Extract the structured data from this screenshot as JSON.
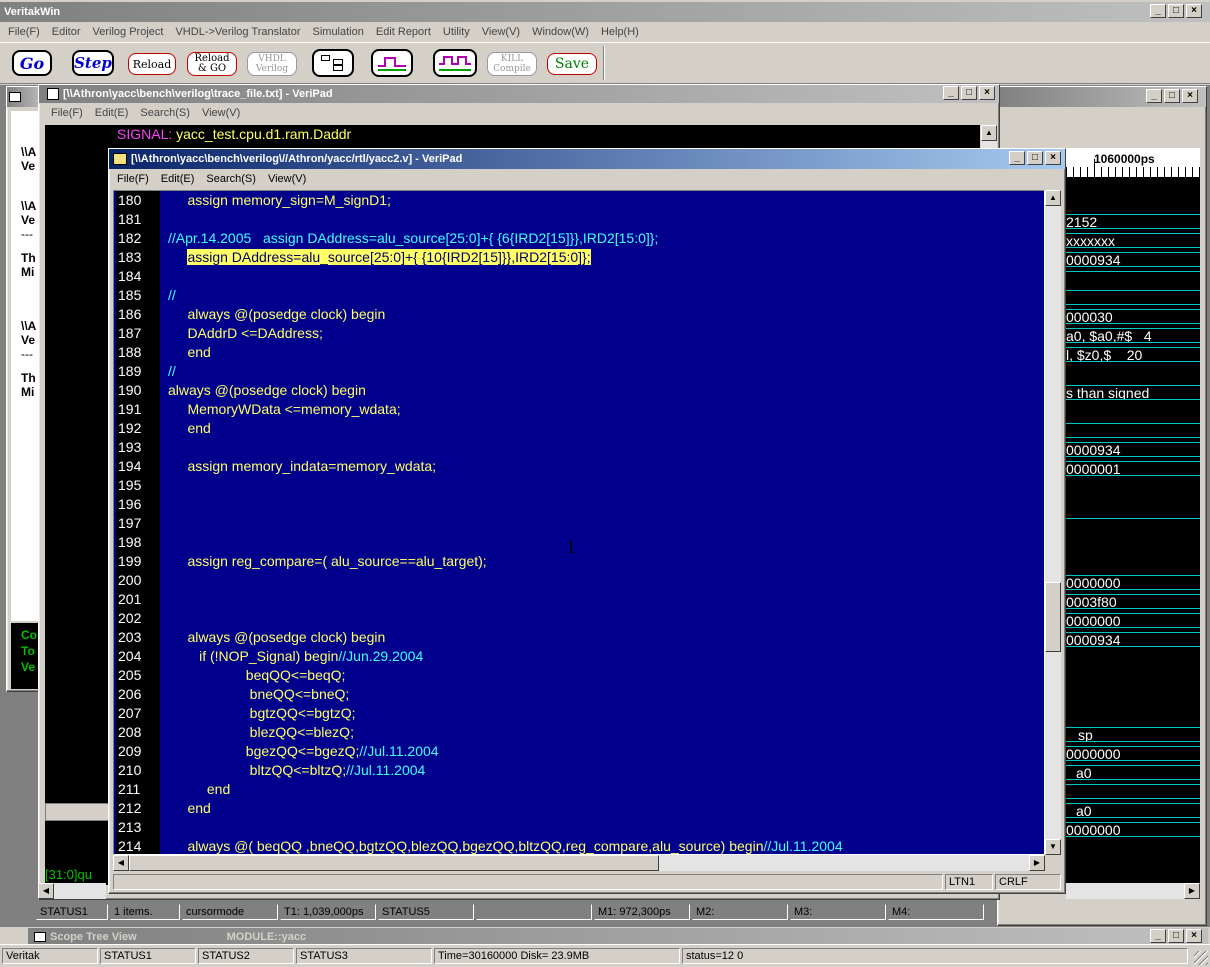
{
  "app": {
    "title": "VeritakWin",
    "menu": [
      "File(F)",
      "Editor",
      "Verilog Project",
      "VHDL->Verilog Translator",
      "Simulation",
      "Edit Report",
      "Utility",
      "View(V)",
      "Window(W)",
      "Help(H)"
    ],
    "toolbar": {
      "go": "Go",
      "step": "Step",
      "reload": "Reload",
      "reload_go_1": "Reload",
      "reload_go_2": "& GO",
      "vhdl_1": "VHDL",
      "vhdl_2": "Verilog",
      "kill_1": "KILL",
      "kill_2": "Compile",
      "save": "Save"
    },
    "status": [
      "Veritak",
      "STATUS1",
      "STATUS2",
      "STATUS3",
      "Time=30160000 Disk= 23.9MB",
      "status=12 0"
    ]
  },
  "trace_window": {
    "title": "[\\\\Athron\\yacc\\bench\\verilog\\trace_file.txt] - VeriPad",
    "menu": [
      "File(F)",
      "Edit(E)",
      "Search(S)",
      "View(V)"
    ],
    "signal_label": "SIGNAL:",
    "signal_value": "yacc_test.cpu.d1.ram.Daddr",
    "bottom_text": "[31:0]qu"
  },
  "left_window": {
    "fragments": [
      "\\\\A",
      "Ve",
      "\\\\A",
      "Ve",
      "---",
      "Th",
      "Mi",
      "\\\\A",
      "Ve",
      "---",
      "Th",
      "Mi"
    ],
    "green": [
      "Co",
      "To",
      "Ve"
    ]
  },
  "editor": {
    "title": "[\\\\Athron\\yacc\\bench\\verilog\\//Athron/yacc/rtl/yacc2.v] - VeriPad",
    "menu": [
      "File(F)",
      "Edit(E)",
      "Search(S)",
      "View(V)"
    ],
    "lines": [
      {
        "n": "180",
        "segs": [
          {
            "t": "     assign memory_sign=M_signD1;",
            "c": ""
          }
        ]
      },
      {
        "n": "181",
        "segs": []
      },
      {
        "n": "182",
        "segs": [
          {
            "t": "//Apr.14.2005   assign DAddress=alu_source[25:0]+{ {6{IRD2[15]}},IRD2[15:0]};",
            "c": "cm"
          }
        ]
      },
      {
        "n": "183",
        "segs": [
          {
            "t": "     assign DAddress=alu_source[25:0]+{ {10{IRD2[15]}},IRD2[15:0]};",
            "c": ""
          }
        ],
        "hl": true
      },
      {
        "n": "184",
        "segs": []
      },
      {
        "n": "185",
        "segs": [
          {
            "t": "//",
            "c": "cm"
          }
        ]
      },
      {
        "n": "186",
        "segs": [
          {
            "t": "     always @(posedge clock) begin",
            "c": ""
          }
        ]
      },
      {
        "n": "187",
        "segs": [
          {
            "t": "     DAddrD <=DAddress;",
            "c": ""
          }
        ]
      },
      {
        "n": "188",
        "segs": [
          {
            "t": "     end",
            "c": ""
          }
        ]
      },
      {
        "n": "189",
        "segs": [
          {
            "t": "//",
            "c": "cm"
          }
        ]
      },
      {
        "n": "190",
        "segs": [
          {
            "t": "always @(posedge clock) begin",
            "c": ""
          }
        ]
      },
      {
        "n": "191",
        "segs": [
          {
            "t": "     MemoryWData <=memory_wdata;",
            "c": ""
          }
        ]
      },
      {
        "n": "192",
        "segs": [
          {
            "t": "     end",
            "c": ""
          }
        ]
      },
      {
        "n": "193",
        "segs": []
      },
      {
        "n": "194",
        "segs": [
          {
            "t": "     assign memory_indata=memory_wdata;",
            "c": ""
          }
        ]
      },
      {
        "n": "195",
        "segs": []
      },
      {
        "n": "196",
        "segs": []
      },
      {
        "n": "197",
        "segs": []
      },
      {
        "n": "198",
        "segs": []
      },
      {
        "n": "199",
        "segs": [
          {
            "t": "     assign reg_compare=( alu_source==alu_target);",
            "c": ""
          }
        ]
      },
      {
        "n": "200",
        "segs": []
      },
      {
        "n": "201",
        "segs": []
      },
      {
        "n": "202",
        "segs": []
      },
      {
        "n": "203",
        "segs": [
          {
            "t": "     always @(posedge clock) begin",
            "c": ""
          }
        ]
      },
      {
        "n": "204",
        "segs": [
          {
            "t": "        if (!NOP_Signal) begin",
            "c": ""
          },
          {
            "t": "//Jun.29.2004",
            "c": "cm"
          }
        ]
      },
      {
        "n": "205",
        "segs": [
          {
            "t": "                    beqQQ<=beqQ;",
            "c": ""
          }
        ]
      },
      {
        "n": "206",
        "segs": [
          {
            "t": "                     bneQQ<=bneQ;",
            "c": ""
          }
        ]
      },
      {
        "n": "207",
        "segs": [
          {
            "t": "                     bgtzQQ<=bgtzQ;",
            "c": ""
          }
        ]
      },
      {
        "n": "208",
        "segs": [
          {
            "t": "                     blezQQ<=blezQ;",
            "c": ""
          }
        ]
      },
      {
        "n": "209",
        "segs": [
          {
            "t": "                    bgezQQ<=bgezQ;",
            "c": ""
          },
          {
            "t": "//Jul.11.2004",
            "c": "cm"
          }
        ]
      },
      {
        "n": "210",
        "segs": [
          {
            "t": "                     bltzQQ<=bltzQ;",
            "c": ""
          },
          {
            "t": "//Jul.11.2004",
            "c": "cm"
          }
        ]
      },
      {
        "n": "211",
        "segs": [
          {
            "t": "          end",
            "c": ""
          }
        ]
      },
      {
        "n": "212",
        "segs": [
          {
            "t": "     end",
            "c": ""
          }
        ]
      },
      {
        "n": "213",
        "segs": []
      },
      {
        "n": "214",
        "segs": [
          {
            "t": "     always @( beqQQ ,bneQQ,bgtzQQ,blezQQ,bgezQQ,bltzQQ,reg_compare,alu_source) begin",
            "c": ""
          },
          {
            "t": "//Jul.11.2004",
            "c": "cm"
          }
        ]
      }
    ],
    "status_line": "LTN1",
    "status_eol": "CRLF"
  },
  "wave_window": {
    "time_label": "1060000ps",
    "signals": [
      {
        "text": "2152"
      },
      {
        "text": "xxxxxxx"
      },
      {
        "text": "0000934"
      },
      {
        "text": "000030"
      },
      {
        "text": "a0, $a0,#$   4"
      },
      {
        "text": "l, $z0,$    20"
      },
      {
        "text": "s than signed"
      },
      {
        "text": ""
      },
      {
        "text": "0000934"
      },
      {
        "text": "0000001"
      },
      {
        "text": "0000000"
      },
      {
        "text": "0003f80"
      },
      {
        "text": "0000000"
      },
      {
        "text": "0000934"
      },
      {
        "text": "sp"
      },
      {
        "text": "0000000"
      },
      {
        "text": "a0"
      },
      {
        "text": "a0"
      },
      {
        "text": "0000000"
      }
    ],
    "status": [
      "STATUS1",
      "1 items.",
      "cursormode",
      "T1: 1,039,000ps",
      "STATUS5",
      "",
      "M1: 972,300ps",
      "M2:",
      "M3:",
      "M4:"
    ]
  },
  "scope_tree": {
    "title": "Scope Tree View",
    "module": "MODULE::yacc"
  }
}
